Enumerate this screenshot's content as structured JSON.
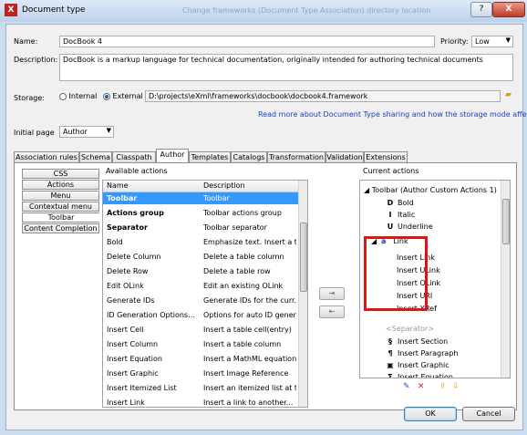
{
  "window": {
    "title": "Document type",
    "ghost_title": "Change frameworks (Document Type Association) directory location",
    "help_glyph": "?",
    "close_glyph": "X",
    "app_icon_glyph": "X"
  },
  "form": {
    "name_label": "Name:",
    "name_value": "DocBook 4",
    "priority_label": "Priority:",
    "priority_value": "Low",
    "description_label": "Description:",
    "description_value": "DocBook is a markup language for technical documentation, originally intended for authoring technical documents",
    "storage_label": "Storage:",
    "storage_internal": "Internal",
    "storage_external": "External",
    "storage_path": "D:\\projects\\eXml\\frameworks\\docbook\\docbook4.framework",
    "read_more_link": "Read more about Document Type sharing and how the storage mode affects it",
    "initial_page_label": "Initial page",
    "initial_page_value": "Author"
  },
  "tabs": [
    "Association rules",
    "Schema",
    "Classpath",
    "Author",
    "Templates",
    "Catalogs",
    "Transformation",
    "Validation",
    "Extensions"
  ],
  "side_items": [
    "CSS",
    "Actions",
    "Menu",
    "Contextual menu",
    "Toolbar",
    "Content Completion"
  ],
  "available": {
    "label": "Available actions",
    "col_name": "Name",
    "col_description": "Description",
    "rows": [
      {
        "name": "Toolbar",
        "desc": "Toolbar"
      },
      {
        "name": "Actions group",
        "desc": "Toolbar actions group"
      },
      {
        "name": "Separator",
        "desc": "Toolbar separator"
      },
      {
        "name": "Bold",
        "desc": "Emphasize text. Insert a t..."
      },
      {
        "name": "Delete Column",
        "desc": "Delete a table column"
      },
      {
        "name": "Delete Row",
        "desc": "Delete a table row"
      },
      {
        "name": "Edit OLink",
        "desc": "Edit an existing OLink"
      },
      {
        "name": "Generate IDs",
        "desc": "Generate IDs for the curr..."
      },
      {
        "name": "ID Generation Options...",
        "desc": "Options for auto ID gener..."
      },
      {
        "name": "Insert Cell",
        "desc": "Insert a table cell(entry)"
      },
      {
        "name": "Insert Column",
        "desc": "Insert a table column"
      },
      {
        "name": "Insert Equation",
        "desc": "Insert a MathML equation"
      },
      {
        "name": "Insert Graphic",
        "desc": "Insert Image Reference"
      },
      {
        "name": "Insert Itemized List",
        "desc": "Insert an itemized list at t..."
      },
      {
        "name": "Insert Link",
        "desc": "Insert a link to another..."
      }
    ]
  },
  "move_buttons": {
    "add": "⇥",
    "remove": "⇤"
  },
  "current": {
    "label": "Current actions",
    "toolbar_node": "Toolbar (Author Custom Actions 1)",
    "items": [
      {
        "icon": "D",
        "label": "Bold"
      },
      {
        "icon": "I",
        "label": "Italic"
      },
      {
        "icon": "U",
        "label": "Underline"
      }
    ],
    "link_group": "Link",
    "link_children": [
      "Insert Link",
      "Insert ULink",
      "Insert OLink",
      "Insert URI",
      "Insert XRef"
    ],
    "separator": "<Separator>",
    "more_items": [
      {
        "icon": "§",
        "label": "Insert Section"
      },
      {
        "icon": "¶",
        "label": "Insert Paragraph"
      },
      {
        "icon": "▣",
        "label": "Insert Graphic"
      },
      {
        "icon": "Σ",
        "label": "Insert Equation"
      }
    ]
  },
  "buttons": {
    "ok": "OK",
    "cancel": "Cancel"
  },
  "colors": {
    "selection": "#3399ff",
    "highlight_box": "#e01414",
    "link": "#1a3fc0"
  }
}
